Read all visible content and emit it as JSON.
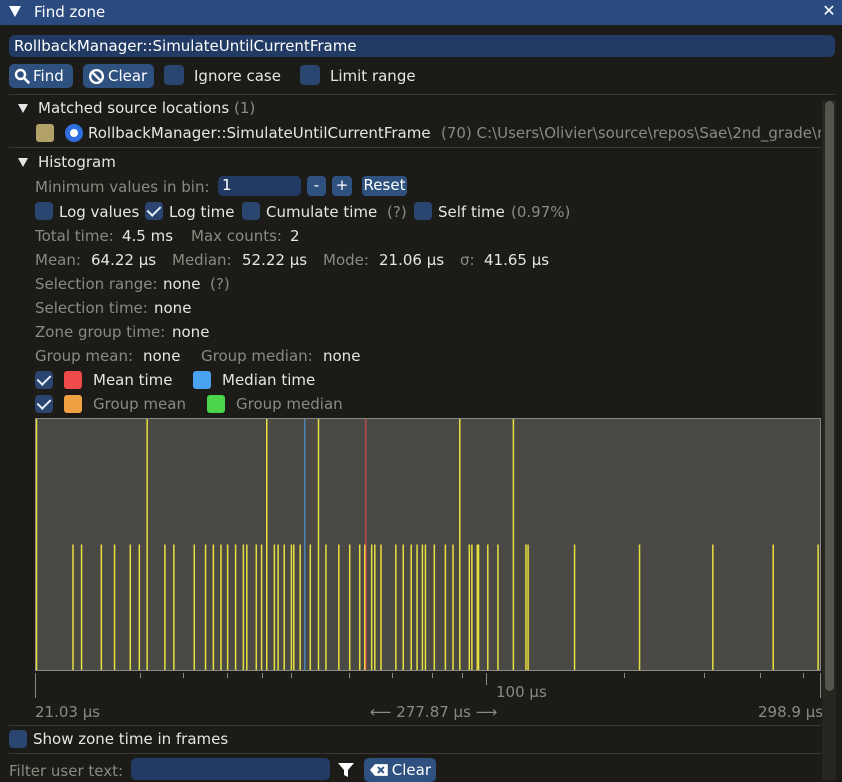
{
  "window": {
    "title": "Find zone",
    "close_glyph": "✕"
  },
  "search": {
    "value": "RollbackManager::SimulateUntilCurrentFrame"
  },
  "toolbar": {
    "find_label": "Find",
    "clear_label": "Clear",
    "ignore_case_label": "Ignore case",
    "limit_range_label": "Limit range"
  },
  "matched": {
    "heading": "Matched source locations",
    "count": "(1)",
    "item": {
      "name": "RollbackManager::SimulateUntilCurrentFrame",
      "path": "(70) C:\\Users\\Olivier\\source\\repos\\Sae\\2nd_grade\\r",
      "color": "#b2a26a"
    }
  },
  "histogram": {
    "heading": "Histogram",
    "min_values_label": "Minimum values in bin:",
    "min_values_value": "1",
    "minus": "-",
    "plus": "+",
    "reset": "Reset",
    "log_values": "Log values",
    "log_time": "Log time",
    "cumulate_time": "Cumulate time",
    "cumulate_hint": "(?)",
    "self_time": "Self time",
    "self_time_pct": "(0.97%)",
    "total_time_label": "Total time:",
    "total_time": "4.5 ms",
    "max_counts_label": "Max counts:",
    "max_counts": "2",
    "mean_label": "Mean:",
    "mean": "64.22 µs",
    "median_label": "Median:",
    "median": "52.22 µs",
    "mode_label": "Mode:",
    "mode": "21.06 µs",
    "sigma_label": "σ:",
    "sigma": "41.65 µs",
    "selection_range_label": "Selection range:",
    "selection_range": "none",
    "selection_range_hint": "(?)",
    "selection_time_label": "Selection time:",
    "selection_time": "none",
    "zone_group_time_label": "Zone group time:",
    "zone_group_time": "none",
    "group_mean_label": "Group mean:",
    "group_mean": "none",
    "group_median_label": "Group median:",
    "group_median": "none",
    "mean_time_legend": "Mean time",
    "median_time_legend": "Median time",
    "group_mean_legend": "Group mean",
    "group_median_legend": "Group median",
    "colors": {
      "mean": "#f04b4b",
      "median": "#4aa3f0",
      "group_mean": "#f0a040",
      "group_median": "#4ad44a",
      "bar": "#e8e040"
    },
    "axis_min": "21.03 µs",
    "axis_range": "277.87 µs",
    "axis_mid": "100 µs",
    "axis_max": "298.9 µs"
  },
  "chart_data": {
    "type": "bar",
    "xlabel": "",
    "ylabel": "",
    "x_scale": "log",
    "xlim": [
      21.03,
      298.9
    ],
    "ylim": [
      0,
      2
    ],
    "mean": 64.22,
    "median": 52.22,
    "bins_x": [
      21.03,
      23.8,
      24.5,
      26.2,
      27.4,
      28.9,
      29.8,
      30.6,
      32.5,
      33.5,
      35.9,
      37.3,
      38.3,
      39.3,
      40.2,
      41.3,
      42.4,
      42.9,
      44.3,
      45.1,
      45.9,
      47.1,
      47.7,
      48.7,
      49.9,
      50.3,
      51.4,
      53.2,
      54.7,
      56.1,
      58.6,
      60.8,
      62.9,
      64.0,
      65.5,
      66.2,
      67.6,
      71.1,
      72.9,
      74.9,
      76.4,
      77.8,
      78.6,
      81.0,
      84.1,
      86.3,
      88.3,
      91.2,
      92.0,
      93.7,
      94.1,
      97.1,
      100.5,
      105.9,
      110.5,
      111.3,
      130.3,
      162.4,
      208.2,
      255.5,
      297.5
    ],
    "bins_count": [
      2,
      1,
      1,
      1,
      1,
      1,
      1,
      2,
      1,
      1,
      1,
      1,
      1,
      1,
      1,
      1,
      1,
      1,
      1,
      1,
      2,
      1,
      1,
      1,
      1,
      1,
      1,
      1,
      2,
      1,
      1,
      1,
      1,
      1,
      1,
      1,
      1,
      1,
      1,
      1,
      1,
      1,
      1,
      1,
      1,
      1,
      2,
      1,
      1,
      1,
      1,
      1,
      1,
      2,
      1,
      1,
      1,
      1,
      1,
      1,
      1
    ]
  },
  "footer": {
    "show_frames_label": "Show zone time in frames",
    "filter_label": "Filter user text:",
    "filter_value": "",
    "clear_label": "Clear"
  }
}
